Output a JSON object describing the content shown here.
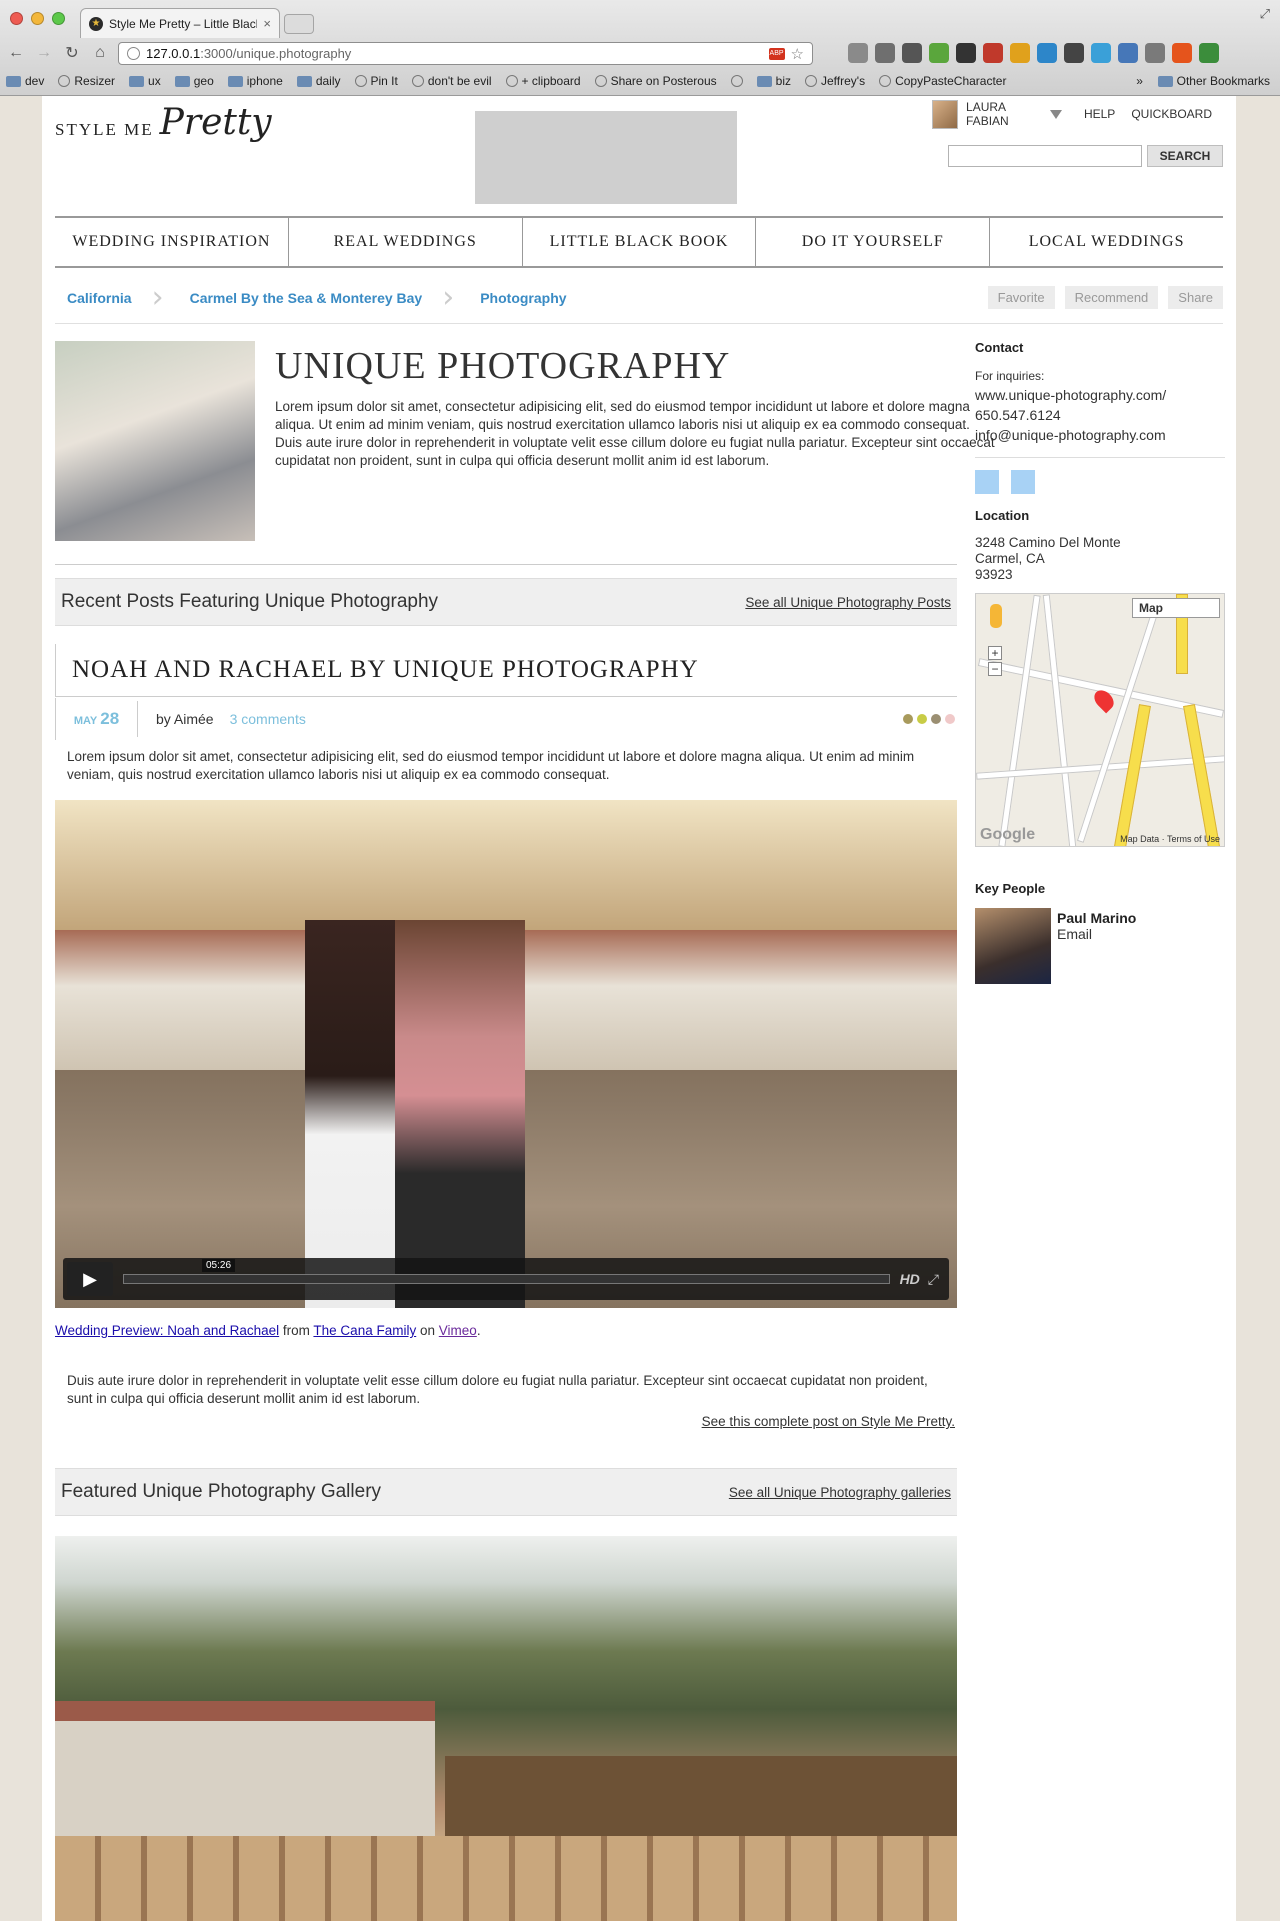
{
  "browser": {
    "tab_title": "Style Me Pretty – Little Black",
    "url_host": "127.0.0.1",
    "url_path": ":3000/unique.photography",
    "bookmarks": [
      "dev",
      "Resizer",
      "ux",
      "geo",
      "iphone",
      "daily",
      "Pin It",
      "don't be evil",
      "+ clipboard",
      "Share on Posterous",
      "biz",
      "Jeffrey's",
      "CopyPasteCharacter"
    ],
    "other_bookmarks": "Other Bookmarks"
  },
  "site": {
    "logo_text": "STYLE ME",
    "logo_script": "Pretty",
    "user_name": "LAURA FABIAN",
    "help": "HELP",
    "quickboard": "QUICKBOARD",
    "search_button": "SEARCH",
    "nav": [
      "WEDDING INSPIRATION",
      "REAL WEDDINGS",
      "LITTLE BLACK BOOK",
      "DO IT YOURSELF",
      "LOCAL WEDDINGS"
    ]
  },
  "breadcrumb": [
    "California",
    "Carmel By the Sea & Monterey Bay",
    "Photography"
  ],
  "actions": [
    "Favorite",
    "Recommend",
    "Share"
  ],
  "business": {
    "title": "UNIQUE PHOTOGRAPHY",
    "description": "Lorem ipsum dolor sit amet, consectetur adipisicing elit, sed do eiusmod tempor incididunt ut labore et dolore magna aliqua. Ut enim ad minim veniam, quis nostrud exercitation ullamco laboris nisi ut aliquip ex ea commodo consequat. Duis aute irure dolor in reprehenderit in voluptate velit esse cillum dolore eu fugiat nulla pariatur. Excepteur sint occaecat cupidatat non proident, sunt in culpa qui officia deserunt mollit anim id est laborum."
  },
  "sidebar": {
    "contact_heading": "Contact",
    "for_inquiries": "For inquiries:",
    "website": "www.unique-photography.com/",
    "phone": "650.547.6124",
    "email": "info@unique-photography.com",
    "location_heading": "Location",
    "address1": "3248 Camino Del Monte",
    "address2": "Carmel, CA",
    "zip": "93923",
    "map_type": "Map",
    "map_footer": "Map Data · Terms of Use",
    "google": "Google",
    "key_people_heading": "Key People",
    "person_name": "Paul Marino",
    "person_email": "Email"
  },
  "recent": {
    "heading": "Recent Posts Featuring Unique Photography",
    "link": "See all Unique Photography Posts"
  },
  "post": {
    "title": "NOAH AND RACHAEL BY UNIQUE PHOTOGRAPHY",
    "month": "MAY",
    "day": "28",
    "byline": "by Aimée",
    "comments": "3 comments",
    "text1": "Lorem ipsum dolor sit amet, consectetur adipisicing elit, sed do eiusmod tempor incididunt ut labore et dolore magna aliqua. Ut enim ad minim veniam, quis nostrud exercitation ullamco laboris nisi ut aliquip ex ea commodo consequat.",
    "video_time": "05:26",
    "video_hd": "HD",
    "video_link": "Wedding Preview: Noah and Rachael",
    "from": "from",
    "author_link": "The Cana Family",
    "on": "on",
    "vimeo": "Vimeo",
    "period": ".",
    "text2": "Duis aute irure dolor in reprehenderit in voluptate velit esse cillum dolore eu fugiat nulla pariatur. Excepteur sint occaecat cupidatat non proident, sunt in culpa qui officia deserunt mollit anim id est laborum.",
    "see_full": "See this complete post on Style Me Pretty."
  },
  "gallery": {
    "heading": "Featured Unique Photography Gallery",
    "link": "See all Unique Photography galleries"
  },
  "colors": {
    "link_blue": "#3a8bc4",
    "date_blue": "#7cbfdc",
    "dot1": "#a89a5c",
    "dot2": "#c8cc46",
    "dot3": "#9b8f72",
    "dot4": "#f0c9c9"
  }
}
